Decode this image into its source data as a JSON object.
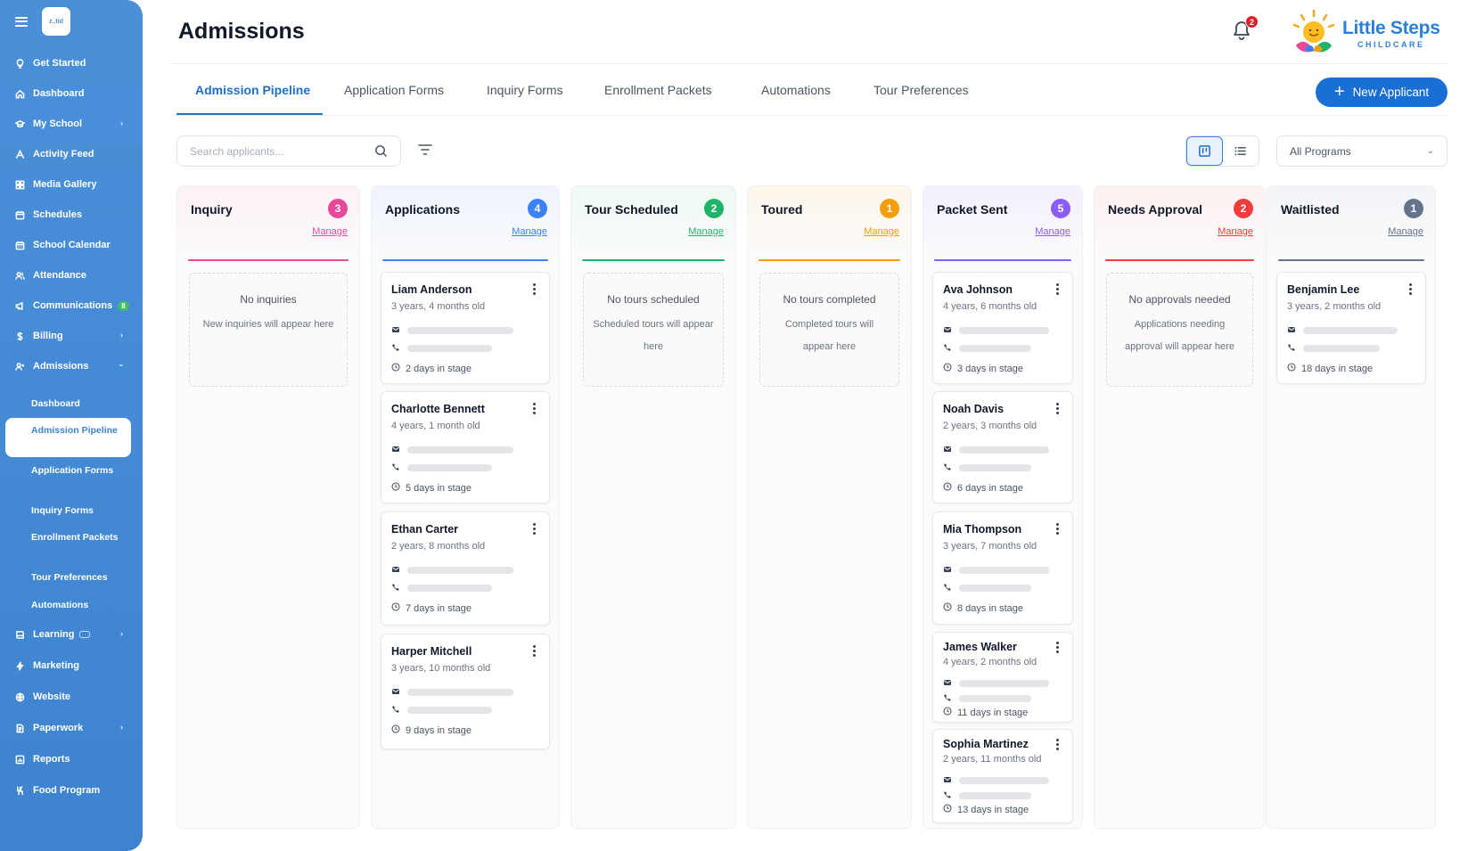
{
  "app": {
    "page_title": "Admissions",
    "notifications_count": "2",
    "logo_mini": "z..tid"
  },
  "brand": {
    "name": "Little Steps",
    "tagline": "CHILDCARE"
  },
  "sidebar": {
    "items": [
      {
        "label": "Get Started",
        "icon": "lightbulb-icon"
      },
      {
        "label": "Dashboard",
        "icon": "home-icon"
      },
      {
        "label": "My School",
        "icon": "graduation-cap-icon"
      },
      {
        "label": "Activity Feed",
        "icon": "activity-icon"
      },
      {
        "label": "Media Gallery",
        "icon": "grid-icon"
      },
      {
        "label": "Schedules",
        "icon": "calendar-icon"
      },
      {
        "label": "School Calendar",
        "icon": "calendar-days-icon"
      },
      {
        "label": "Attendance",
        "icon": "users-icon"
      },
      {
        "label": "Communications",
        "icon": "megaphone-icon",
        "count": "8"
      },
      {
        "label": "Billing",
        "icon": "dollar-icon"
      },
      {
        "label": "Admissions",
        "icon": "user-plus-icon"
      },
      {
        "label": "Learning",
        "icon": "book-icon"
      },
      {
        "label": "Marketing",
        "icon": "rocket-icon"
      },
      {
        "label": "Website",
        "icon": "globe-icon"
      },
      {
        "label": "Paperwork",
        "icon": "document-icon"
      },
      {
        "label": "Reports",
        "icon": "chart-icon"
      },
      {
        "label": "Food Program",
        "icon": "utensils-icon"
      }
    ],
    "admissions_sub": [
      "Dashboard",
      "Admission Pipeline",
      "Application Forms",
      "Inquiry Forms",
      "Enrollment Packets",
      "Tour Preferences",
      "Automations"
    ]
  },
  "tabs": [
    "Admission Pipeline",
    "Application Forms",
    "Inquiry Forms",
    "Enrollment Packets",
    "Automations",
    "Tour Preferences"
  ],
  "new_applicant_label": "New Applicant",
  "search": {
    "placeholder": "Search applicants..."
  },
  "program_filter": {
    "selected": "All Programs"
  },
  "manage_label": "Manage",
  "colors": {
    "sidebar": "#4a90d9",
    "accent": "#1a6fd4",
    "inquiry": "#e8489a",
    "applications": "#3b82f6",
    "tour_scheduled": "#22b36a",
    "toured": "#f59e0b",
    "packet_sent": "#8b5cf6",
    "needs_approval": "#ef3d3d",
    "waitlisted": "#64748b"
  },
  "columns": [
    {
      "name": "Inquiry",
      "count": "3",
      "empty_title": "No inquiries",
      "empty_sub": "New inquiries will appear here",
      "cards": []
    },
    {
      "name": "Applications",
      "count": "4",
      "cards": [
        {
          "name": "Liam Anderson",
          "age": "3 years, 4 months old",
          "stage": "2 days in stage"
        },
        {
          "name": "Charlotte Bennett",
          "age": "4 years, 1 month old",
          "stage": "5 days in stage"
        },
        {
          "name": "Ethan Carter",
          "age": "2 years, 8 months old",
          "stage": "7 days in stage"
        },
        {
          "name": "Harper Mitchell",
          "age": "3 years, 10 months old",
          "stage": "9 days in stage"
        }
      ]
    },
    {
      "name": "Tour Scheduled",
      "count": "2",
      "empty_title": "No tours scheduled",
      "empty_sub": "Scheduled tours will appear here",
      "cards": []
    },
    {
      "name": "Toured",
      "count": "1",
      "empty_title": "No tours completed",
      "empty_sub": "Completed tours will appear here",
      "cards": []
    },
    {
      "name": "Packet Sent",
      "count": "5",
      "cards": [
        {
          "name": "Ava Johnson",
          "age": "4 years, 6 months old",
          "stage": "3 days in stage"
        },
        {
          "name": "Noah Davis",
          "age": "2 years, 3 months old",
          "stage": "6 days in stage"
        },
        {
          "name": "Mia Thompson",
          "age": "3 years, 7 months old",
          "stage": "8 days in stage"
        },
        {
          "name": "James Walker",
          "age": "4 years, 2 months old",
          "stage": "11 days in stage"
        },
        {
          "name": "Sophia Martinez",
          "age": "2 years, 11 months old",
          "stage": "13 days in stage"
        }
      ]
    },
    {
      "name": "Needs Approval",
      "count": "2",
      "empty_title": "No approvals needed",
      "empty_sub": "Applications needing approval will appear here",
      "cards": []
    },
    {
      "name": "Waitlisted",
      "count": "1",
      "cards": [
        {
          "name": "Benjamin Lee",
          "age": "3 years, 2 months old",
          "stage": "18 days in stage"
        }
      ]
    }
  ]
}
